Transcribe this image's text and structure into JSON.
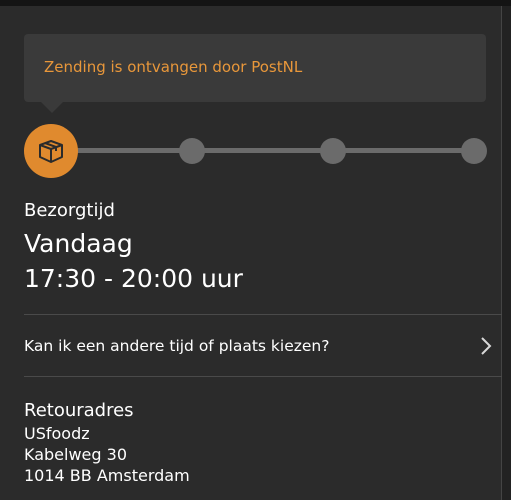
{
  "status": {
    "message": "Zending is ontvangen door PostNL",
    "accent_color": "#e8973a"
  },
  "progress": {
    "steps": 4,
    "current_step": 1,
    "active_icon": "package-icon",
    "active_color": "#e08a2e",
    "inactive_color": "#6b6b6b"
  },
  "delivery": {
    "label": "Bezorgtijd",
    "day": "Vandaag",
    "time": "17:30 - 20:00 uur"
  },
  "change_option": {
    "label": "Kan ik een andere tijd of plaats kiezen?",
    "icon": "chevron-right-icon"
  },
  "return_address": {
    "label": "Retouradres",
    "name": "USfoodz",
    "street": "Kabelweg 30",
    "city": "1014 BB Amsterdam"
  }
}
